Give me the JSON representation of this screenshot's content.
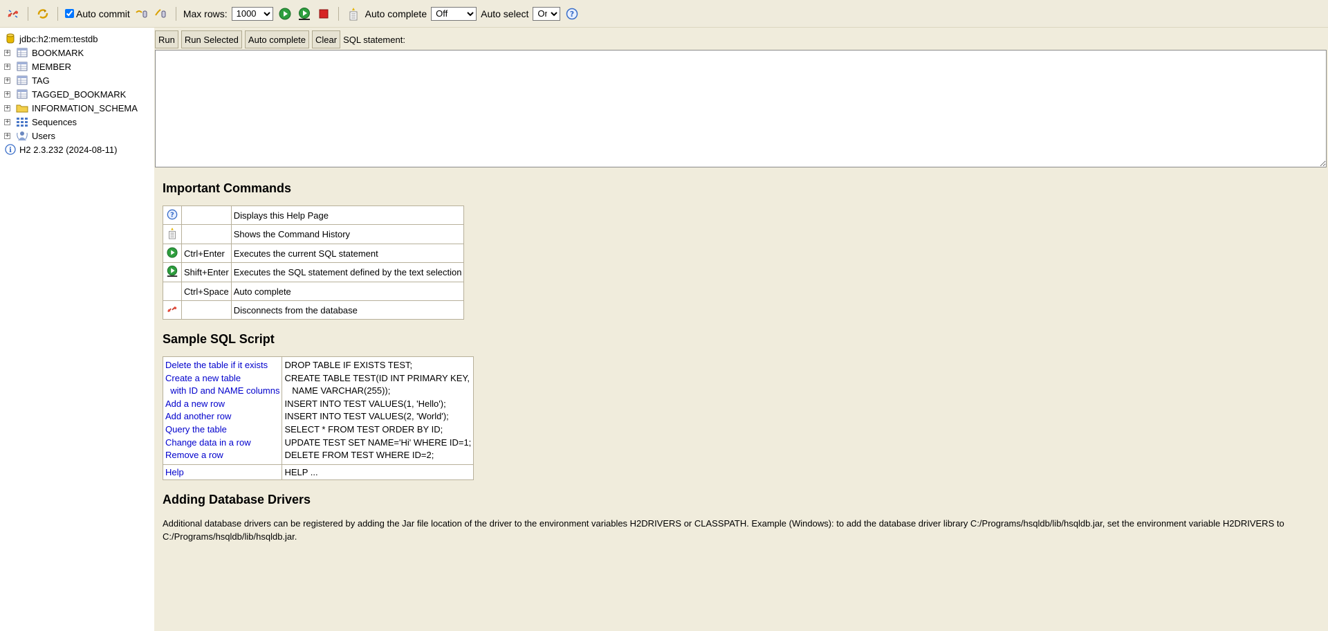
{
  "toolbar": {
    "auto_commit_label": "Auto commit",
    "max_rows_label": "Max rows:",
    "max_rows_value": "1000",
    "auto_complete_label": "Auto complete",
    "auto_complete_value": "Off",
    "auto_select_label": "Auto select",
    "auto_select_value": "On"
  },
  "tree": {
    "connection": "jdbc:h2:mem:testdb",
    "items": [
      {
        "label": "BOOKMARK",
        "icon": "table-icon"
      },
      {
        "label": "MEMBER",
        "icon": "table-icon"
      },
      {
        "label": "TAG",
        "icon": "table-icon"
      },
      {
        "label": "TAGGED_BOOKMARK",
        "icon": "table-icon"
      },
      {
        "label": "INFORMATION_SCHEMA",
        "icon": "folder-icon"
      },
      {
        "label": "Sequences",
        "icon": "sequences-icon"
      },
      {
        "label": "Users",
        "icon": "users-icon"
      }
    ],
    "version": "H2 2.3.232 (2024-08-11)"
  },
  "sql": {
    "run": "Run",
    "run_selected": "Run Selected",
    "auto_complete": "Auto complete",
    "clear": "Clear",
    "label": "SQL statement:"
  },
  "help": {
    "important_title": "Important Commands",
    "commands": [
      {
        "icon": "help-icon",
        "key": "",
        "desc": "Displays this Help Page"
      },
      {
        "icon": "history-icon",
        "key": "",
        "desc": "Shows the Command History"
      },
      {
        "icon": "run-icon",
        "key": "Ctrl+Enter",
        "desc": "Executes the current SQL statement"
      },
      {
        "icon": "run-selected-icon",
        "key": "Shift+Enter",
        "desc": "Executes the SQL statement defined by the text selection"
      },
      {
        "icon": "",
        "key": "Ctrl+Space",
        "desc": "Auto complete"
      },
      {
        "icon": "disconnect-icon",
        "key": "",
        "desc": "Disconnects from the database"
      }
    ],
    "sample_title": "Sample SQL Script",
    "sample": {
      "links": [
        "Delete the table if it exists",
        "Create a new table",
        "  with ID and NAME columns",
        "Add a new row",
        "Add another row",
        "Query the table",
        "Change data in a row",
        "Remove a row"
      ],
      "sql": [
        "DROP TABLE IF EXISTS TEST;",
        "CREATE TABLE TEST(ID INT PRIMARY KEY,",
        "   NAME VARCHAR(255));",
        "INSERT INTO TEST VALUES(1, 'Hello');",
        "INSERT INTO TEST VALUES(2, 'World');",
        "SELECT * FROM TEST ORDER BY ID;",
        "UPDATE TEST SET NAME='Hi' WHERE ID=1;",
        "DELETE FROM TEST WHERE ID=2;"
      ],
      "help_link": "Help",
      "help_sql": "HELP ..."
    },
    "drivers_title": "Adding Database Drivers",
    "drivers_text": "Additional database drivers can be registered by adding the Jar file location of the driver to the environment variables H2DRIVERS or CLASSPATH. Example (Windows): to add the database driver library C:/Programs/hsqldb/lib/hsqldb.jar, set the environment variable H2DRIVERS to C:/Programs/hsqldb/lib/hsqldb.jar."
  }
}
